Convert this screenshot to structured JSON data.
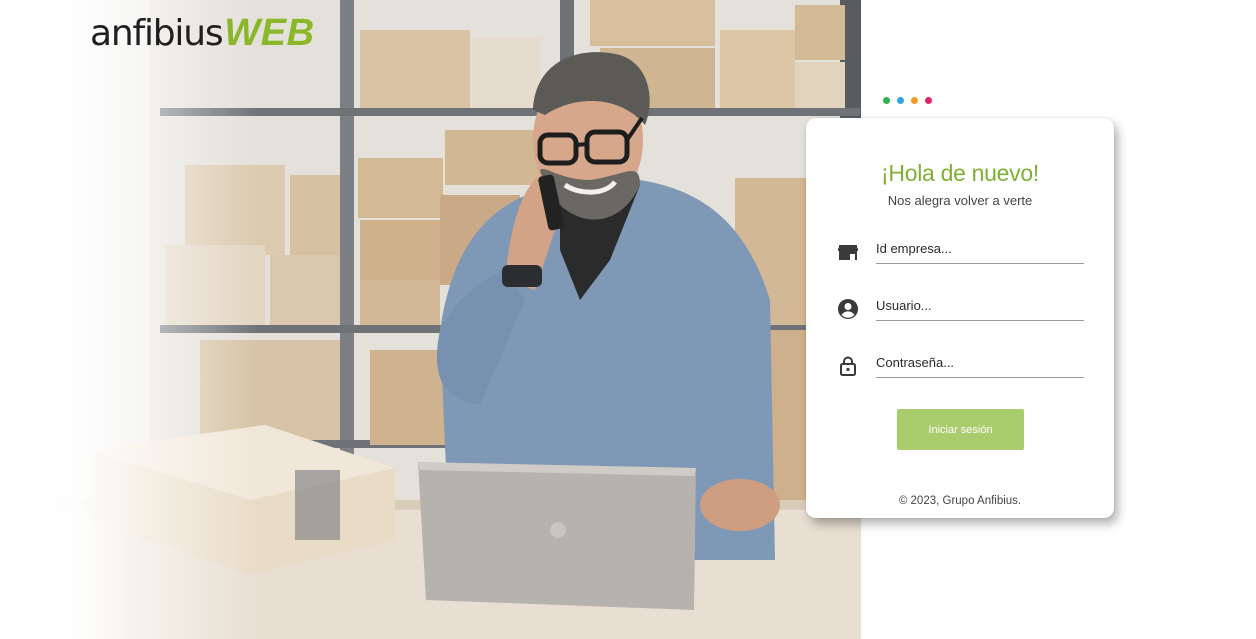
{
  "brand": {
    "logo_part1": "anfibius",
    "logo_part2": "WEB",
    "logo_dark": "#1f1f1f",
    "logo_green": "#8bb72a"
  },
  "dots": [
    {
      "color": "#2db34a"
    },
    {
      "color": "#2ea3e0"
    },
    {
      "color": "#f29b2a"
    },
    {
      "color": "#e0246b"
    }
  ],
  "login": {
    "title": "¡Hola de nuevo!",
    "subtitle": "Nos alegra volver a verte",
    "fields": {
      "company": {
        "placeholder": "Id empresa...",
        "value": "",
        "icon": "store-icon"
      },
      "user": {
        "placeholder": "Usuario...",
        "value": "",
        "icon": "account-circle-icon"
      },
      "password": {
        "placeholder": "Contraseña...",
        "value": "",
        "icon": "lock-icon"
      }
    },
    "submit_label": "Iniciar sesión",
    "footer": "© 2023, Grupo Anfibius.",
    "accent": "#7fb032",
    "button_color": "#a9cc6c"
  },
  "hero": {
    "image_description_icon": "hero-photo"
  }
}
